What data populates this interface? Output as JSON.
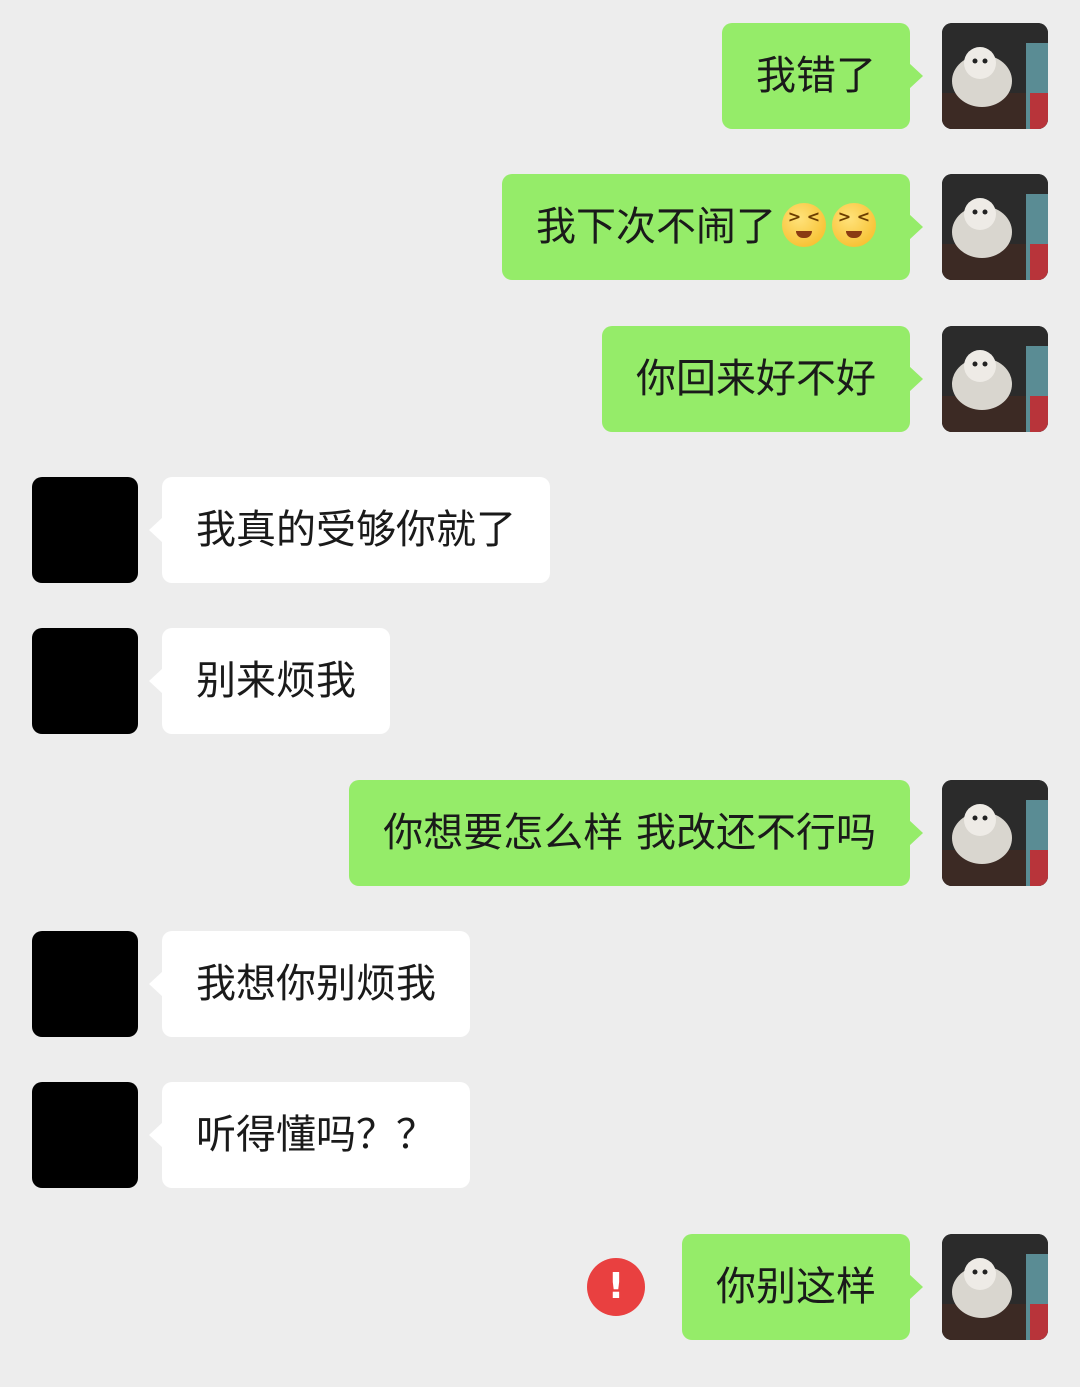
{
  "messages": [
    {
      "from": "me",
      "text": "我错了"
    },
    {
      "from": "me",
      "text": "我下次不闹了",
      "emoji": [
        "crying-face-icon",
        "crying-face-icon"
      ]
    },
    {
      "from": "me",
      "text": "你回来好不好"
    },
    {
      "from": "them",
      "text": "我真的受够你就了"
    },
    {
      "from": "them",
      "text": "别来烦我"
    },
    {
      "from": "me",
      "text": "你想要怎么样 我改还不行吗"
    },
    {
      "from": "them",
      "text": "我想你别烦我"
    },
    {
      "from": "them",
      "text": "听得懂吗？？"
    },
    {
      "from": "me",
      "text": "你别这样",
      "status": "send-failed",
      "status_glyph": "!"
    }
  ],
  "colors": {
    "background": "#ededed",
    "my_bubble": "#95ec69",
    "their_bubble": "#ffffff",
    "error": "#e94040"
  }
}
